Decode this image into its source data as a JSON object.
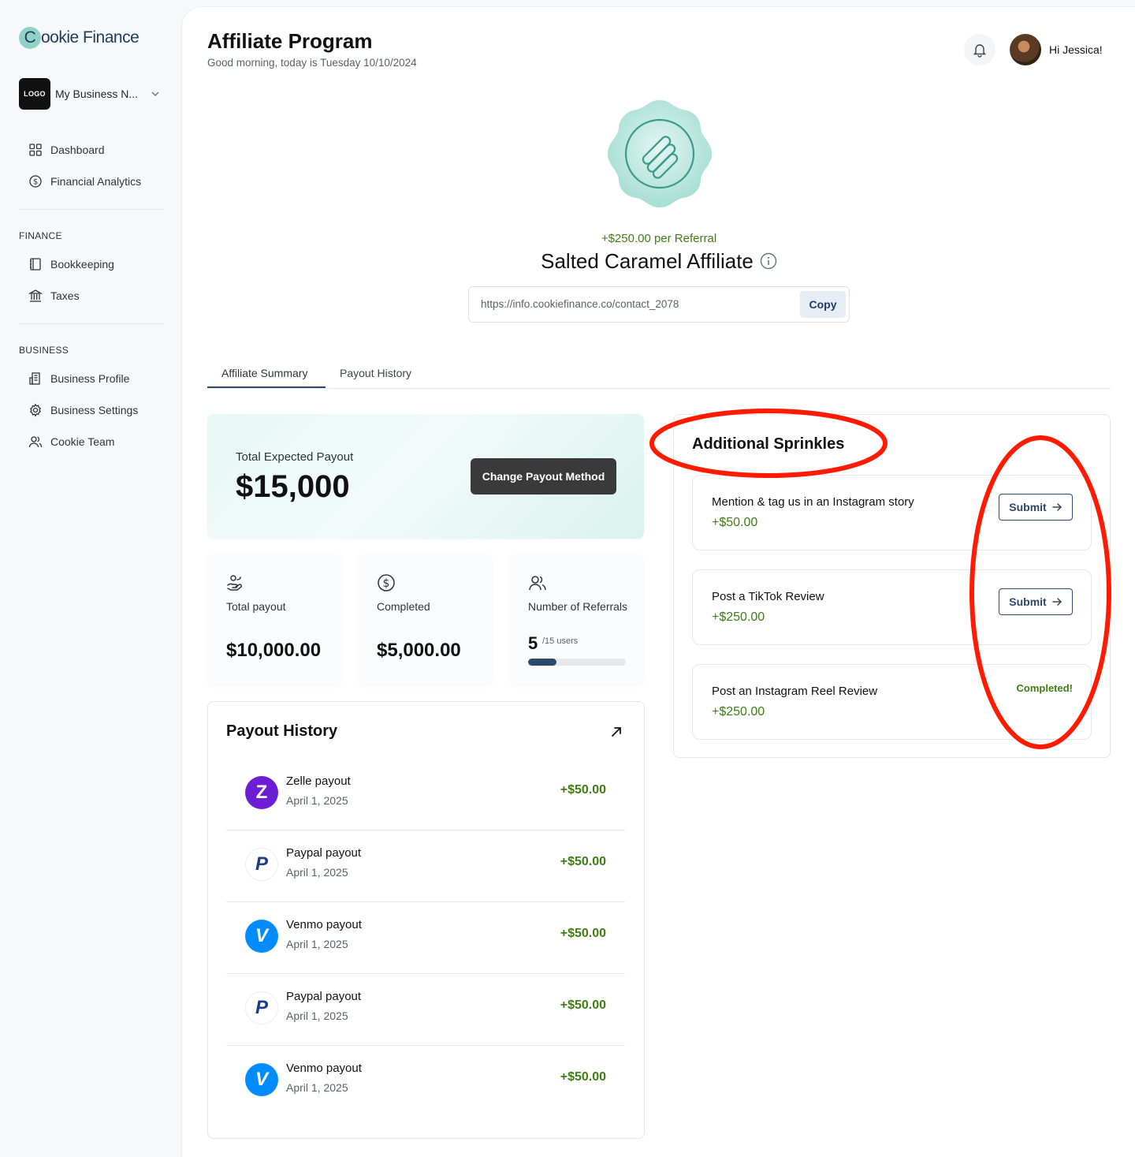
{
  "sidebar": {
    "logo": {
      "c": "C",
      "text": "ookie Finance"
    },
    "business": {
      "logo_text": "LOGO",
      "name": "My Business N..."
    },
    "nav_top": [
      {
        "label": "Dashboard",
        "icon": "dashboard-grid-icon"
      },
      {
        "label": "Financial Analytics",
        "icon": "dollar-circle-icon"
      }
    ],
    "finance_label": "FINANCE",
    "nav_finance": [
      {
        "label": "Bookkeeping",
        "icon": "book-icon"
      },
      {
        "label": "Taxes",
        "icon": "bank-icon"
      }
    ],
    "business_label": "BUSINESS",
    "nav_business": [
      {
        "label": "Business Profile",
        "icon": "building-icon"
      },
      {
        "label": "Business Settings",
        "icon": "gear-icon"
      },
      {
        "label": "Cookie Team",
        "icon": "users-icon"
      }
    ]
  },
  "header": {
    "title": "Affiliate Program",
    "subtitle": "Good morning, today is Tuesday 10/10/2024",
    "user_greeting": "Hi Jessica!"
  },
  "affiliate": {
    "per_referral": "+$250.00 per Referral",
    "tier_name": "Salted Caramel Affiliate",
    "link": "https://info.cookiefinance.co/contact_2078",
    "copy_label": "Copy"
  },
  "tabs": [
    {
      "label": "Affiliate Summary",
      "active": true
    },
    {
      "label": "Payout History",
      "active": false
    }
  ],
  "payout_card": {
    "label": "Total Expected Payout",
    "amount": "$15,000",
    "button": "Change Payout Method"
  },
  "stats": {
    "total": {
      "label": "Total payout",
      "value": "$10,000.00"
    },
    "completed": {
      "label": "Completed",
      "value": "$5,000.00"
    },
    "referrals": {
      "label": "Number of Referrals",
      "count": "5",
      "of_text": "/15 users",
      "progress_fraction": 0.29
    }
  },
  "history": {
    "title": "Payout History",
    "rows": [
      {
        "name": "Zelle payout",
        "date": "April 1, 2025",
        "amount": "+$50.00",
        "method": "zelle"
      },
      {
        "name": "Paypal payout",
        "date": "April 1, 2025",
        "amount": "+$50.00",
        "method": "paypal"
      },
      {
        "name": "Venmo payout",
        "date": "April 1, 2025",
        "amount": "+$50.00",
        "method": "venmo"
      },
      {
        "name": "Paypal payout",
        "date": "April 1, 2025",
        "amount": "+$50.00",
        "method": "paypal"
      },
      {
        "name": "Venmo payout",
        "date": "April 1, 2025",
        "amount": "+$50.00",
        "method": "venmo"
      }
    ]
  },
  "sprinkles": {
    "title": "Additional Sprinkles",
    "items": [
      {
        "name": "Mention & tag us in an Instagram story",
        "amount": "+$50.00",
        "action": "Submit"
      },
      {
        "name": "Post a TikTok Review",
        "amount": "+$250.00",
        "action": "Submit"
      },
      {
        "name": "Post an Instagram Reel Review",
        "amount": "+$250.00",
        "status": "Completed!"
      }
    ]
  },
  "colors": {
    "accent_green": "#3f7d14",
    "brand_navy": "#2b4a6b",
    "annotation_red": "#ff1a00",
    "zelle": "#6d1ed4",
    "venmo": "#008cff"
  }
}
